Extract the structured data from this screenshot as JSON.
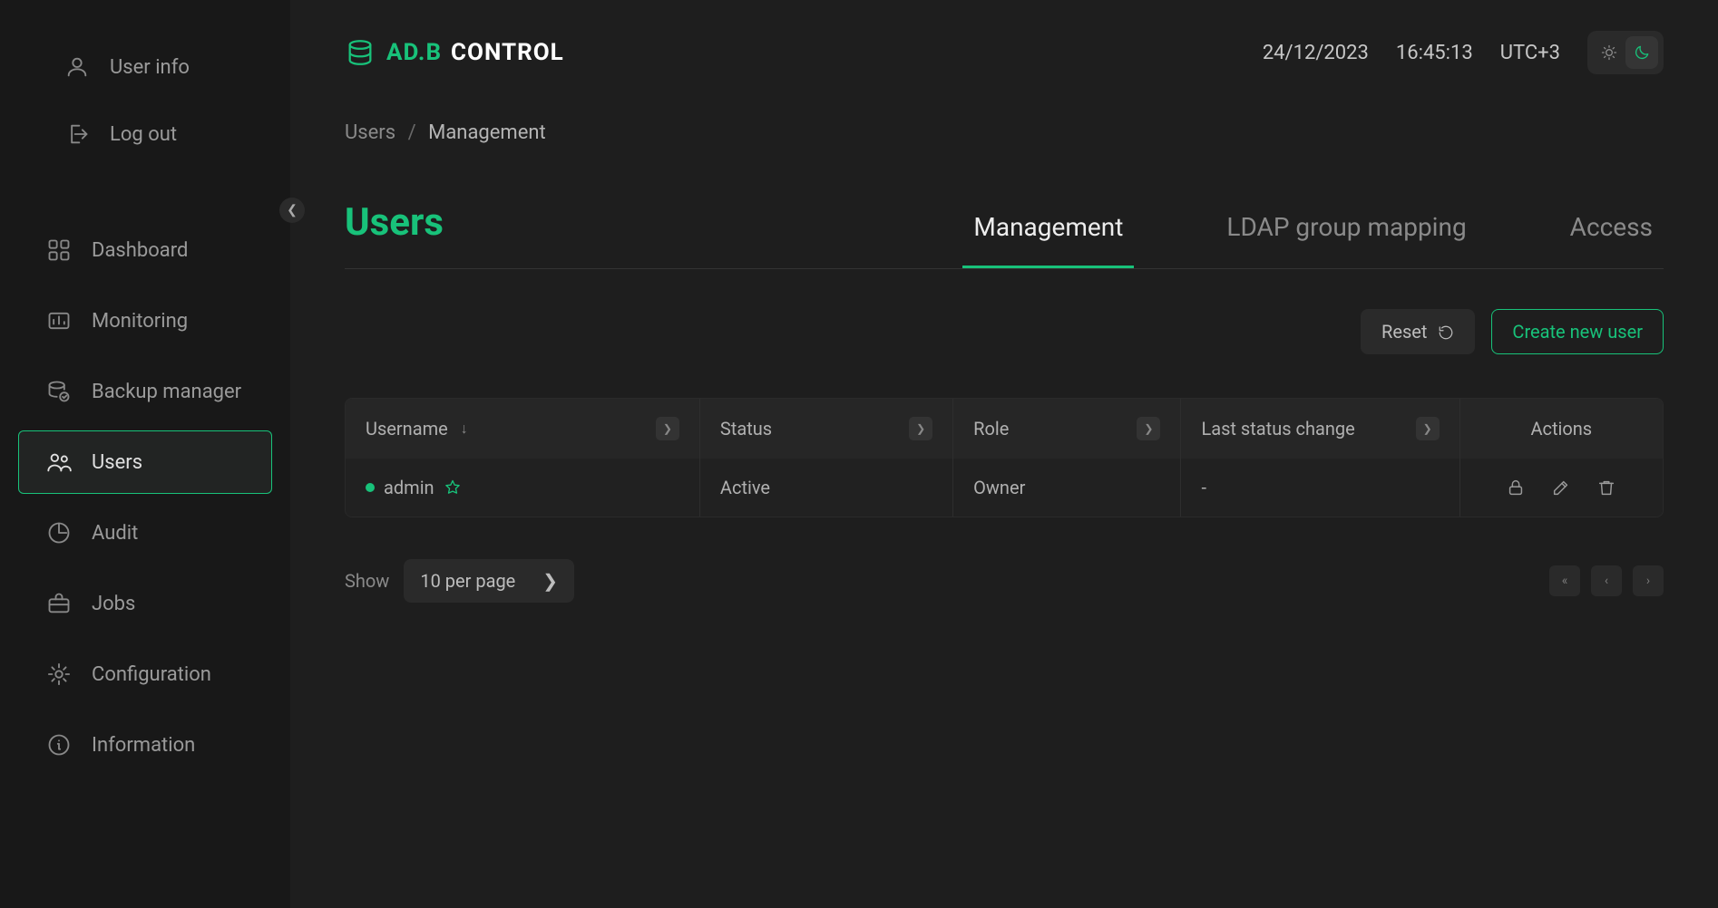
{
  "header": {
    "brand_primary": "AD.B",
    "brand_secondary": "CONTROL",
    "date": "24/12/2023",
    "time": "16:45:13",
    "tz": "UTC+3"
  },
  "sidebar": {
    "top_items": [
      {
        "icon": "user",
        "label": "User info"
      },
      {
        "icon": "logout",
        "label": "Log out"
      }
    ],
    "items": [
      {
        "icon": "dashboard",
        "label": "Dashboard",
        "active": false
      },
      {
        "icon": "monitoring",
        "label": "Monitoring",
        "active": false
      },
      {
        "icon": "backup",
        "label": "Backup manager",
        "active": false
      },
      {
        "icon": "users",
        "label": "Users",
        "active": true
      },
      {
        "icon": "audit",
        "label": "Audit",
        "active": false
      },
      {
        "icon": "jobs",
        "label": "Jobs",
        "active": false
      },
      {
        "icon": "configuration",
        "label": "Configuration",
        "active": false
      },
      {
        "icon": "information",
        "label": "Information",
        "active": false
      }
    ]
  },
  "breadcrumb": {
    "root": "Users",
    "current": "Management"
  },
  "page": {
    "title": "Users"
  },
  "tabs": [
    {
      "label": "Management",
      "active": true
    },
    {
      "label": "LDAP group mapping",
      "active": false
    },
    {
      "label": "Access",
      "active": false
    }
  ],
  "toolbar": {
    "reset_label": "Reset",
    "create_label": "Create new user"
  },
  "table": {
    "columns": {
      "username": "Username",
      "status": "Status",
      "role": "Role",
      "lastchange": "Last status change",
      "actions": "Actions"
    },
    "rows": [
      {
        "username": "admin",
        "starred": true,
        "status_dot": "green",
        "status": "Active",
        "role": "Owner",
        "last_change": "-"
      }
    ]
  },
  "pagination": {
    "show_label": "Show",
    "per_page": "10 per page"
  }
}
